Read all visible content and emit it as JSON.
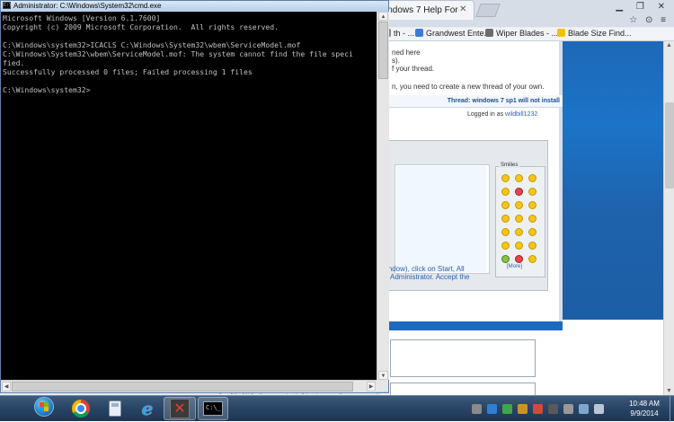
{
  "browser": {
    "tab_title": "indows 7 Help For",
    "bookmarks": [
      "th - ...",
      "Grandwest Ente...",
      "Wiper Blades - ...",
      "Blade Size Find..."
    ],
    "page": {
      "line1": "ned here",
      "line2": "s).",
      "line3": "f your thread.",
      "line4": "n, you need to create a new thread of your own.",
      "thread_label": "Thread:",
      "thread_title": "windows 7 sp1 will not install",
      "logged_in_prefix": "Logged in as",
      "logged_in_user": "wildbill1232",
      "smilies_label": "Smilies",
      "more_link": "[More]",
      "body_line1": "indow), click on Start, All",
      "body_line2": "Administrator. Accept the"
    },
    "valid_extensions": "Valid file extensions: bat doc docx gif log jpeg jpg log msi osdx pdf png ps1 psd rar reg txt vbs wav zip"
  },
  "cmd": {
    "title": "Administrator: C:\\Windows\\System32\\cmd.exe",
    "console_text": "Microsoft Windows [Version 6.1.7600]\nCopyright (c) 2009 Microsoft Corporation.  All rights reserved.\n\nC:\\Windows\\system32>ICACLS C:\\Windows\\System32\\wbem\\ServiceModel.mof\nC:\\Windows\\System32\\wbem\\ServiceModel.mof: The system cannot find the file speci\nfied.\nSuccessfully processed 0 files; Failed processing 1 files\n\nC:\\Windows\\system32>"
  },
  "taskbar": {
    "items": [
      "chrome",
      "calculator",
      "internet-explorer",
      "xmind",
      "cmd"
    ],
    "clock_time": "10:48 AM",
    "clock_date": "9/9/2014"
  }
}
